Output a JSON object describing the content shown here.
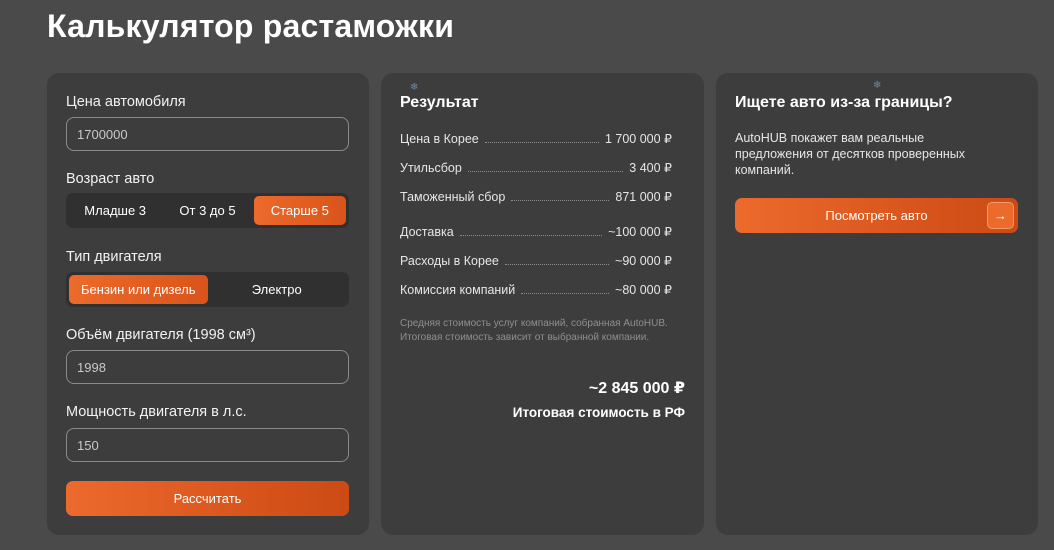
{
  "page": {
    "title": "Калькулятор растаможки"
  },
  "form": {
    "price_label": "Цена автомобиля",
    "price_value": "1700000",
    "age_label": "Возраст авто",
    "age_options": [
      "Младше 3",
      "От 3 до 5",
      "Старше 5"
    ],
    "age_selected": "Старше 5",
    "engine_type_label": "Тип двигателя",
    "engine_type_options": [
      "Бензин или дизель",
      "Электро"
    ],
    "engine_type_selected": "Бензин или дизель",
    "volume_label": "Объём двигателя (1998 см³)",
    "volume_value": "1998",
    "power_label": "Мощность двигателя в л.с.",
    "power_value": "150",
    "submit_label": "Рассчитать"
  },
  "result": {
    "title": "Результат",
    "rows": [
      {
        "label": "Цена в Корее",
        "value": "1 700 000 ₽"
      },
      {
        "label": "Утильсбор",
        "value": "3 400 ₽"
      },
      {
        "label": "Таможенный сбор",
        "value": "871 000 ₽"
      },
      {
        "label": "Доставка",
        "value": "~100 000 ₽"
      },
      {
        "label": "Расходы в Корее",
        "value": "~90 000 ₽"
      },
      {
        "label": "Комиссия компаний",
        "value": "~80 000 ₽"
      }
    ],
    "note": "Средняя стоимость услуг компаний, собранная AutoHUB. Итоговая стоимость зависит от выбранной компании.",
    "total_value": "~2 845 000 ₽",
    "total_label": "Итоговая стоимость в РФ"
  },
  "promo": {
    "title": "Ищете авто из-за границы?",
    "text": "AutoHUB покажет вам реальные предложения от десятков проверенных компаний.",
    "button_label": "Посмотреть авто",
    "button_icon": "arrow-right-icon"
  },
  "colors": {
    "background": "#4a4a4a",
    "card": "#3d3d3d",
    "accent": "#ec6a2c",
    "accent_dark": "#cc4a14"
  }
}
